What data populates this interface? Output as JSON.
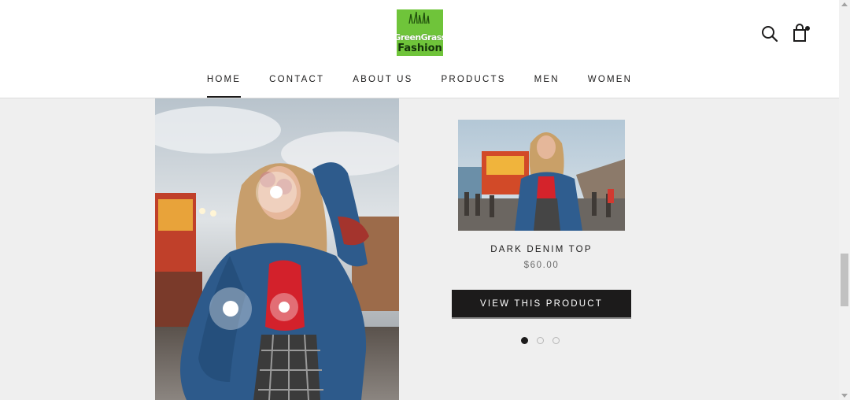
{
  "brand": {
    "line1": "GreenGrass",
    "line2": "Fashion",
    "color": "#6fc43a"
  },
  "header": {
    "search_icon": "search-icon",
    "cart_icon": "shopping-bag-icon"
  },
  "nav": {
    "items": [
      "HOME",
      "CONTACT",
      "ABOUT US",
      "PRODUCTS",
      "MEN",
      "WOMEN"
    ],
    "active": "HOME"
  },
  "hero": {
    "image": "woman-denim-jacket-fairground-photo"
  },
  "product": {
    "image": "woman-denim-jacket-carnival-photo",
    "title": "DARK DENIM TOP",
    "price": "$60.00",
    "button_label": "VIEW THIS PRODUCT"
  },
  "carousel": {
    "slides": 3,
    "active_index": 0
  },
  "colors": {
    "text": "#1c1b1b",
    "button": "#1c1b1b",
    "background": "#efefef"
  }
}
